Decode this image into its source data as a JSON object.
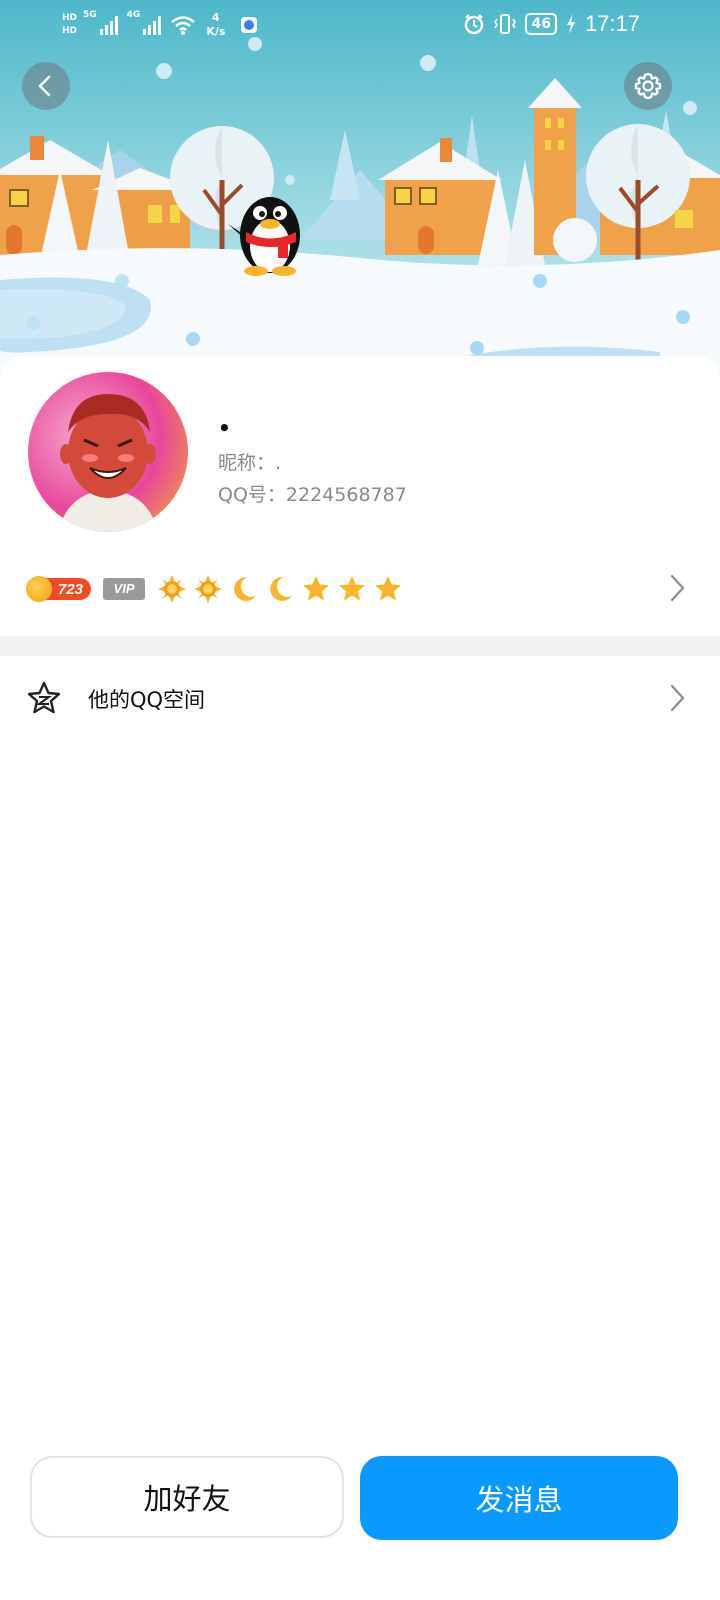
{
  "status_bar": {
    "hd1": "HD",
    "hd2": "HD",
    "net1": "5G",
    "net2": "4G",
    "speed_value": "4",
    "speed_unit": "K/s",
    "battery": "46",
    "time": "17:17"
  },
  "header": {
    "back_icon": "chevron-left-icon",
    "settings_icon": "gear-icon"
  },
  "profile": {
    "display_name": "•",
    "nickname": "昵称：.",
    "qq_number": "QQ号：2224568787",
    "coin_count": "723",
    "vip_label": "VIP",
    "level_icons": [
      "sun",
      "sun",
      "moon",
      "moon",
      "star",
      "star",
      "star"
    ]
  },
  "list": {
    "qzone_label": "他的QQ空间"
  },
  "actions": {
    "add_friend": "加好友",
    "send_message": "发消息"
  },
  "colors": {
    "primary": "#0a99ff",
    "coin_badge": "#f04a27",
    "vip_badge": "#9a9a9a",
    "sky": "#5cc0cf"
  }
}
